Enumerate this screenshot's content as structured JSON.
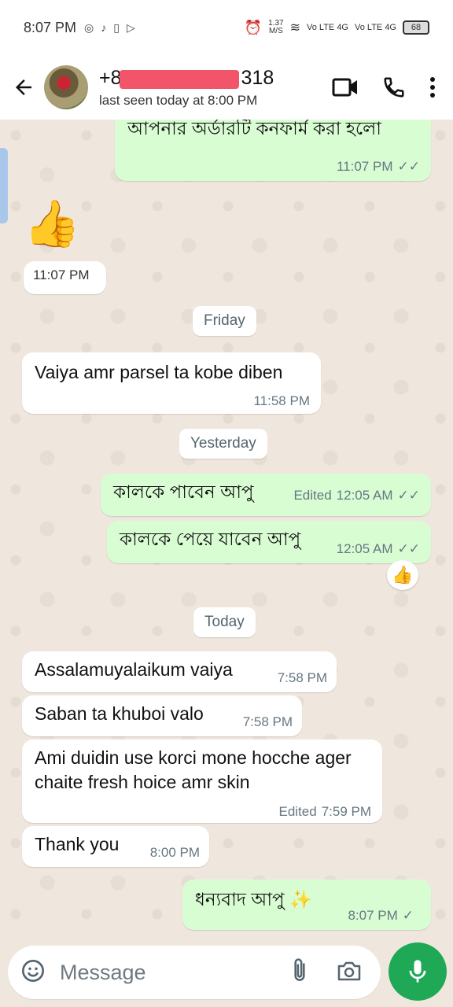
{
  "status_bar": {
    "time": "8:07 PM",
    "speed_value": "1.37",
    "speed_unit": "M/S",
    "network_1": "Vo LTE 4G",
    "network_2": "Vo LTE 4G",
    "battery": "68"
  },
  "header": {
    "contact_name_prefix": "+8",
    "contact_name_suffix": "318",
    "last_seen": "last seen today at 8:00 PM"
  },
  "messages": [
    {
      "text": "আপনার অর্ডারটি কনফার্ম করা হলো",
      "time": "11:07 PM",
      "direction": "out",
      "ticks": "read"
    },
    {
      "text": "👍",
      "time": "11:07 PM",
      "direction": "in"
    },
    {
      "day": "Friday"
    },
    {
      "text": "Vaiya amr parsel ta kobe diben",
      "time": "11:58 PM",
      "direction": "in"
    },
    {
      "day": "Yesterday"
    },
    {
      "text": "কালকে পাবেন আপু",
      "edited": "Edited",
      "time": "12:05 AM",
      "direction": "out",
      "ticks": "read"
    },
    {
      "text": "কালকে পেয়ে যাবেন আপু",
      "time": "12:05 AM",
      "direction": "out",
      "ticks": "read",
      "reaction": "👍"
    },
    {
      "day": "Today"
    },
    {
      "text": "Assalamuyalaikum vaiya",
      "time": "7:58 PM",
      "direction": "in"
    },
    {
      "text": "Saban ta khuboi valo",
      "time": "7:58 PM",
      "direction": "in"
    },
    {
      "text": "Ami duidin use korci mone hocche ager chaite fresh hoice amr skin",
      "edited": "Edited",
      "time": "7:59 PM",
      "direction": "in"
    },
    {
      "text": "Thank you",
      "time": "8:00 PM",
      "direction": "in"
    },
    {
      "text": "ধন্যবাদ আপু ✨",
      "time": "8:07 PM",
      "direction": "out",
      "ticks": "sent"
    }
  ],
  "input": {
    "placeholder": "Message"
  },
  "icons": {
    "back": "back-arrow-icon",
    "video": "video-call-icon",
    "call": "phone-icon",
    "menu": "more-vert-icon",
    "emoji": "emoji-icon",
    "attach": "paperclip-icon",
    "camera": "camera-icon",
    "mic": "microphone-icon"
  },
  "colors": {
    "outgoing_bubble": "#d9fdd3",
    "incoming_bubble": "#ffffff",
    "mic_button": "#1fa855",
    "chat_background": "#efe7dd"
  }
}
